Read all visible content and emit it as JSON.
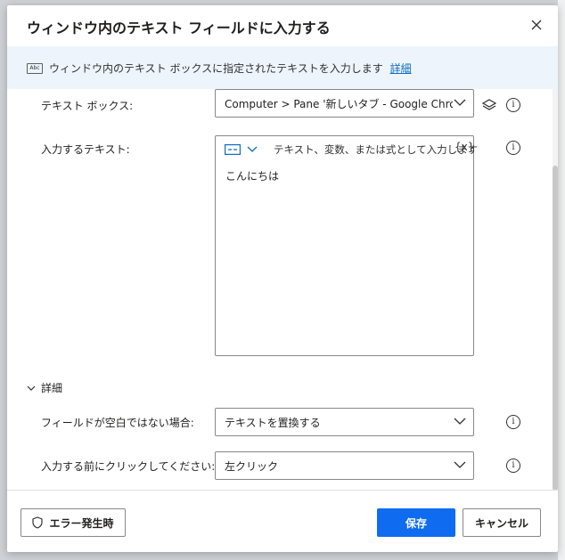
{
  "dialog": {
    "title": "ウィンドウ内のテキスト フィールドに入力する",
    "info": {
      "icon": "text-box-icon",
      "icon_text": "Abc",
      "description": "ウィンドウ内のテキスト ボックスに指定されたテキストを入力します",
      "link": "詳細"
    }
  },
  "form": {
    "textbox": {
      "label": "テキスト ボックス:",
      "value": "Computer > Pane '新しいタブ - Google Chrome - '"
    },
    "text_to_fill": {
      "label": "入力するテキスト:",
      "placeholder": "テキスト、変数、または式として入力します",
      "var_button": "{x}",
      "value": "こんにちは"
    },
    "details": {
      "label": "詳細",
      "if_not_empty": {
        "label": "フィールドが空白ではない場合:",
        "value": "テキストを置換する"
      },
      "click_before": {
        "label": "入力する前にクリックしてください:",
        "value": "左クリック"
      }
    }
  },
  "footer": {
    "on_error": "エラー発生時",
    "save": "保存",
    "cancel": "キャンセル"
  },
  "colors": {
    "accent": "#0f6cf0",
    "link": "#0f6cbd",
    "info_bar": "#edf4fc"
  }
}
